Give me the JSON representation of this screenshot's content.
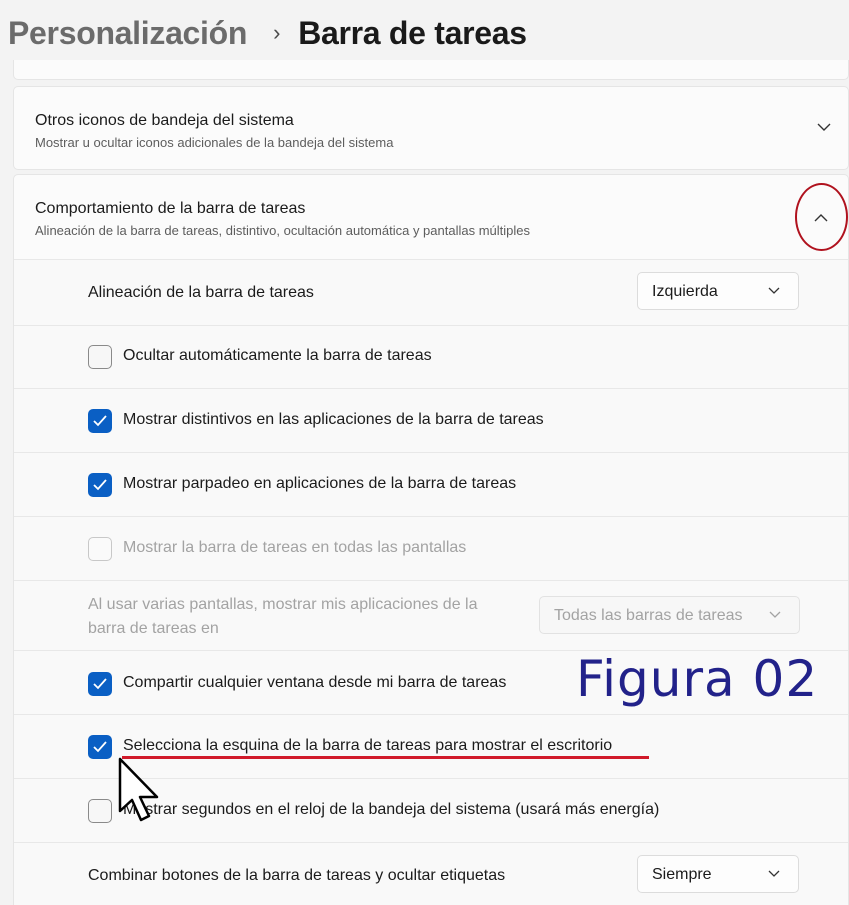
{
  "header": {
    "parent": "Personalización",
    "separator": "›",
    "current": "Barra de tareas"
  },
  "sections": {
    "tray_icons": {
      "title": "Otros iconos de bandeja del sistema",
      "subtitle": "Mostrar u ocultar iconos adicionales de la bandeja del sistema",
      "expanded": false
    },
    "behavior": {
      "title": "Comportamiento de la barra de tareas",
      "subtitle": "Alineación de la barra de tareas, distintivo, ocultación automática y pantallas múltiples",
      "expanded": true
    }
  },
  "settings": {
    "alignment": {
      "label": "Alineación de la barra de tareas",
      "value": "Izquierda"
    },
    "autohide": {
      "label": "Ocultar automáticamente la barra de tareas",
      "checked": false
    },
    "badges": {
      "label": "Mostrar distintivos en las aplicaciones de la barra de tareas",
      "checked": true
    },
    "flashing": {
      "label": "Mostrar parpadeo en aplicaciones de la barra de tareas",
      "checked": true
    },
    "all_displays": {
      "label": "Mostrar la barra de tareas en todas las pantallas",
      "checked": false,
      "disabled": true
    },
    "multi_display": {
      "label_line1": "Al usar varias pantallas, mostrar mis aplicaciones de la",
      "label_line2": "barra de tareas en",
      "value": "Todas las barras de tareas",
      "disabled": true
    },
    "share_window": {
      "label": "Compartir cualquier ventana desde mi barra de tareas",
      "checked": true
    },
    "corner_desktop": {
      "label": "Selecciona la esquina de la barra de tareas para mostrar el escritorio",
      "checked": true
    },
    "seconds_clock": {
      "label": "Mostrar segundos en el reloj de la bandeja del sistema (usará más energía)",
      "checked": false
    },
    "combine_buttons": {
      "label": "Combinar botones de la barra de tareas y ocultar etiquetas",
      "value": "Siempre"
    }
  },
  "annotation": {
    "figure_label": "Figura 02"
  },
  "colors": {
    "accent": "#0a5fc4",
    "annotation_red": "#d11a2a",
    "annotation_blue": "#22228a"
  }
}
